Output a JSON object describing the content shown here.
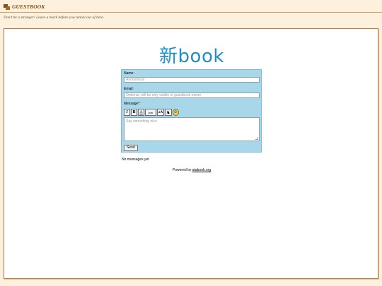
{
  "header": {
    "icon": "chat-bubbles-icon",
    "title": "GUESTBOOK",
    "subtitle": "Don't be a stranger! Leave a mark before you tunnel out of here."
  },
  "logo": {
    "text": "新book",
    "color": "#1f8fc4"
  },
  "form": {
    "name_label": "Name:",
    "name_placeholder": "Anonymous",
    "email_label": "Email:",
    "email_placeholder": "Optional, will be only visible to guestbook owner",
    "message_label": "Message*:",
    "message_placeholder": "Say something nice",
    "send_label": "Send",
    "toolbar": {
      "italic": "I",
      "bold": "B",
      "underline": "A",
      "font": "font",
      "size": "aA",
      "glyph": "♞",
      "smiley": "☺"
    }
  },
  "messages": {
    "empty_text": "No messages yet"
  },
  "footer": {
    "powered_prefix": "Powered by ",
    "powered_link": "atabook.org"
  },
  "colors": {
    "background": "#fdf1de",
    "form_bg": "#a8d7ea",
    "accent": "#8a4b10"
  }
}
